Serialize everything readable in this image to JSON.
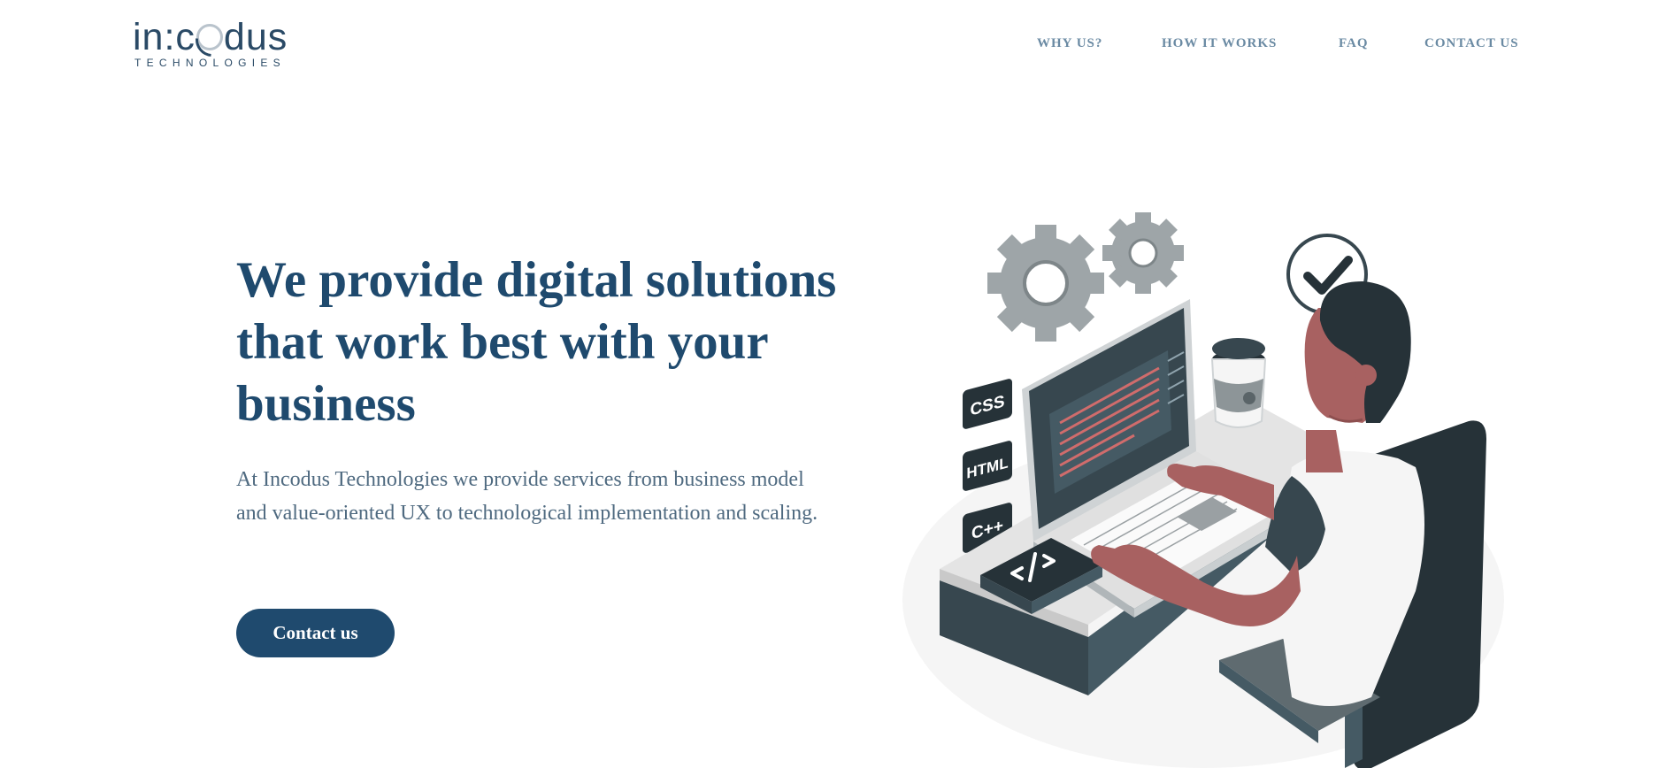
{
  "brand": {
    "logo_main_prefix": "in:c",
    "logo_main_suffix": "dus",
    "logo_sub": "TECHNOLOGIES"
  },
  "nav": {
    "items": [
      {
        "label": "WHY US?"
      },
      {
        "label": "HOW IT WORKS"
      },
      {
        "label": "FAQ"
      },
      {
        "label": "CONTACT US"
      }
    ]
  },
  "hero": {
    "title": "We provide digital solutions that work best with your business",
    "description": "At Incodus Technologies we provide services from business model and value-oriented UX to technological implementation and scaling.",
    "cta_label": "Contact us"
  },
  "illustration": {
    "tags": [
      "CSS",
      "HTML",
      "C++"
    ],
    "colors": {
      "primary": "#1f4a6e",
      "dark": "#263238",
      "skin": "#a86161",
      "gear": "#b0b6b9"
    }
  }
}
